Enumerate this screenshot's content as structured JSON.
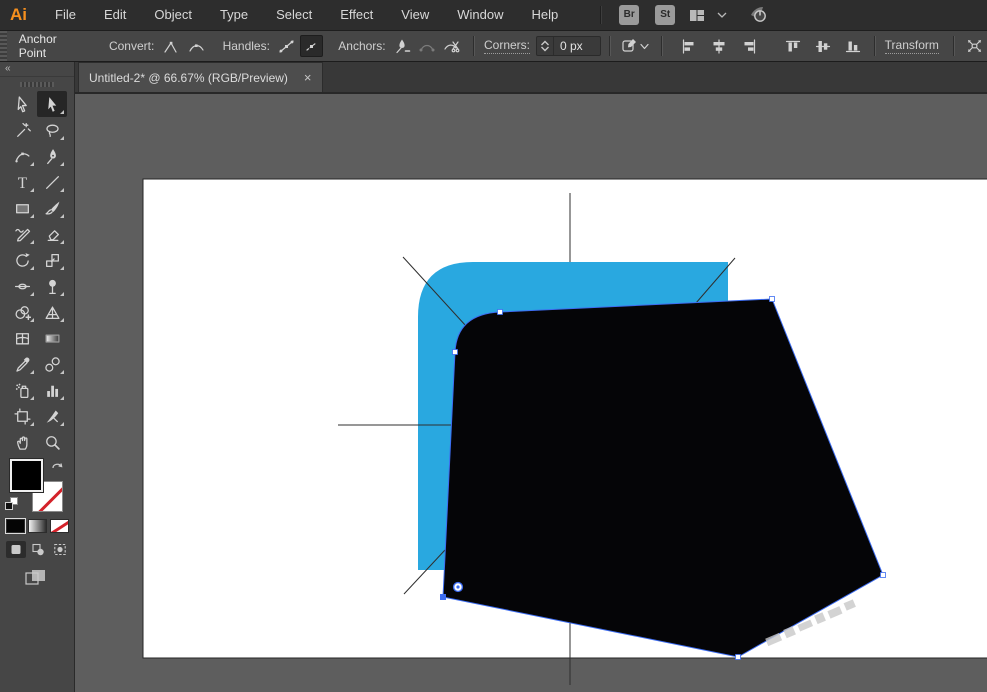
{
  "menu_bar": {
    "logo": "Ai",
    "items": [
      "File",
      "Edit",
      "Object",
      "Type",
      "Select",
      "Effect",
      "View",
      "Window",
      "Help"
    ],
    "bridge_button": "Br",
    "stock_button": "St"
  },
  "control_bar": {
    "title": "Anchor Point",
    "convert_label": "Convert:",
    "handles_label": "Handles:",
    "anchors_label": "Anchors:",
    "corners_label": "Corners:",
    "corners_value": "0 px",
    "transform_label": "Transform"
  },
  "document_tab": {
    "title": "Untitled-2* @ 66.67% (RGB/Preview)",
    "close_label": "×"
  },
  "tool_panel": {
    "collapse_label": "«",
    "selected_tool": "direct-selection-tool",
    "tools": [
      "selection-tool",
      "direct-selection-tool",
      "magic-wand-tool",
      "lasso-tool",
      "curvature-tool",
      "pen-tool",
      "type-tool",
      "line-segment-tool",
      "rectangle-tool",
      "paintbrush-tool",
      "shaper-tool",
      "eraser-tool",
      "rotate-tool",
      "scale-tool",
      "width-tool",
      "puppet-warp-tool",
      "shape-builder-tool",
      "perspective-grid-tool",
      "mesh-tool",
      "gradient-tool",
      "eyedropper-tool",
      "blend-tool",
      "symbol-sprayer-tool",
      "column-graph-tool",
      "artboard-tool",
      "slice-tool",
      "hand-tool",
      "zoom-tool"
    ],
    "fill_color": "#000000",
    "stroke_style": "none"
  },
  "canvas": {
    "artboard_color": "#ffffff",
    "pasteboard_color": "#5e5e5e",
    "shape_blue": "#29a8e0",
    "shape_black": "#050507",
    "selection_blue": "#3d6df2"
  }
}
